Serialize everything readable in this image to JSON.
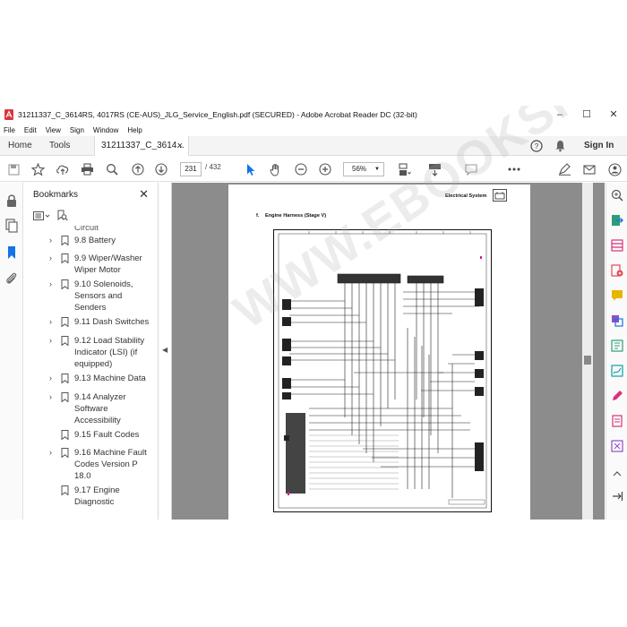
{
  "window": {
    "title": "31211337_C_3614RS, 4017RS (CE-AUS)_JLG_Service_English.pdf (SECURED) - Adobe Acrobat Reader DC (32-bit)",
    "minimize": "–",
    "maximize": "☐",
    "close": "✕"
  },
  "menu": [
    "File",
    "Edit",
    "View",
    "Sign",
    "Window",
    "Help"
  ],
  "tabs": {
    "home": "Home",
    "tools": "Tools",
    "document": "31211337_C_3614...",
    "document_close": "×",
    "help": "?",
    "signin": "Sign In"
  },
  "toolbar": {
    "current_page": "231",
    "total_pages": "/ 432",
    "zoom": "56%"
  },
  "bookmarks": {
    "header": "Bookmarks",
    "close": "✕",
    "items": [
      {
        "label": "Circuit",
        "partial": true
      },
      {
        "label": "9.8 Battery"
      },
      {
        "label": "9.9 Wiper/Washer Wiper Motor"
      },
      {
        "label": "9.10 Solenoids, Sensors and Senders"
      },
      {
        "label": "9.11 Dash Switches"
      },
      {
        "label": "9.12 Load Stability Indicator (LSI) (if equipped)"
      },
      {
        "label": "9.13 Machine Data"
      },
      {
        "label": "9.14 Analyzer Software Accessibility"
      },
      {
        "label": "9.15 Fault Codes"
      },
      {
        "label": "9.16 Machine Fault Codes Version P 18.0"
      },
      {
        "label": "9.17 Engine Diagnostic"
      }
    ]
  },
  "page": {
    "section_header": "Electrical System",
    "subtitle_letter": "f.",
    "subtitle": "Engine Harness (Stage V)",
    "watermark": "WWW.EBOOKSPDF.COM"
  },
  "icons": {
    "left_rail": [
      "lock-icon",
      "pages-icon",
      "bookmark-icon",
      "attachment-icon"
    ],
    "right_rail": [
      "search-zoom-icon",
      "export-pdf-icon",
      "organize-icon",
      "create-pdf-icon",
      "comment-icon",
      "combine-icon",
      "compress-icon",
      "fill-sign-icon",
      "edit-pdf-icon",
      "protect-icon",
      "more-tools-icon"
    ]
  },
  "colors": {
    "accent_blue": "#1473e6",
    "red_tool": "#e34850",
    "pink_tool": "#d9317a",
    "purple_tool": "#8e4ec6",
    "yellow_tool": "#e8b400",
    "green_tool": "#2d9d78",
    "teal_tool": "#0d9ea8",
    "doc_background": "#8c8c8c"
  }
}
